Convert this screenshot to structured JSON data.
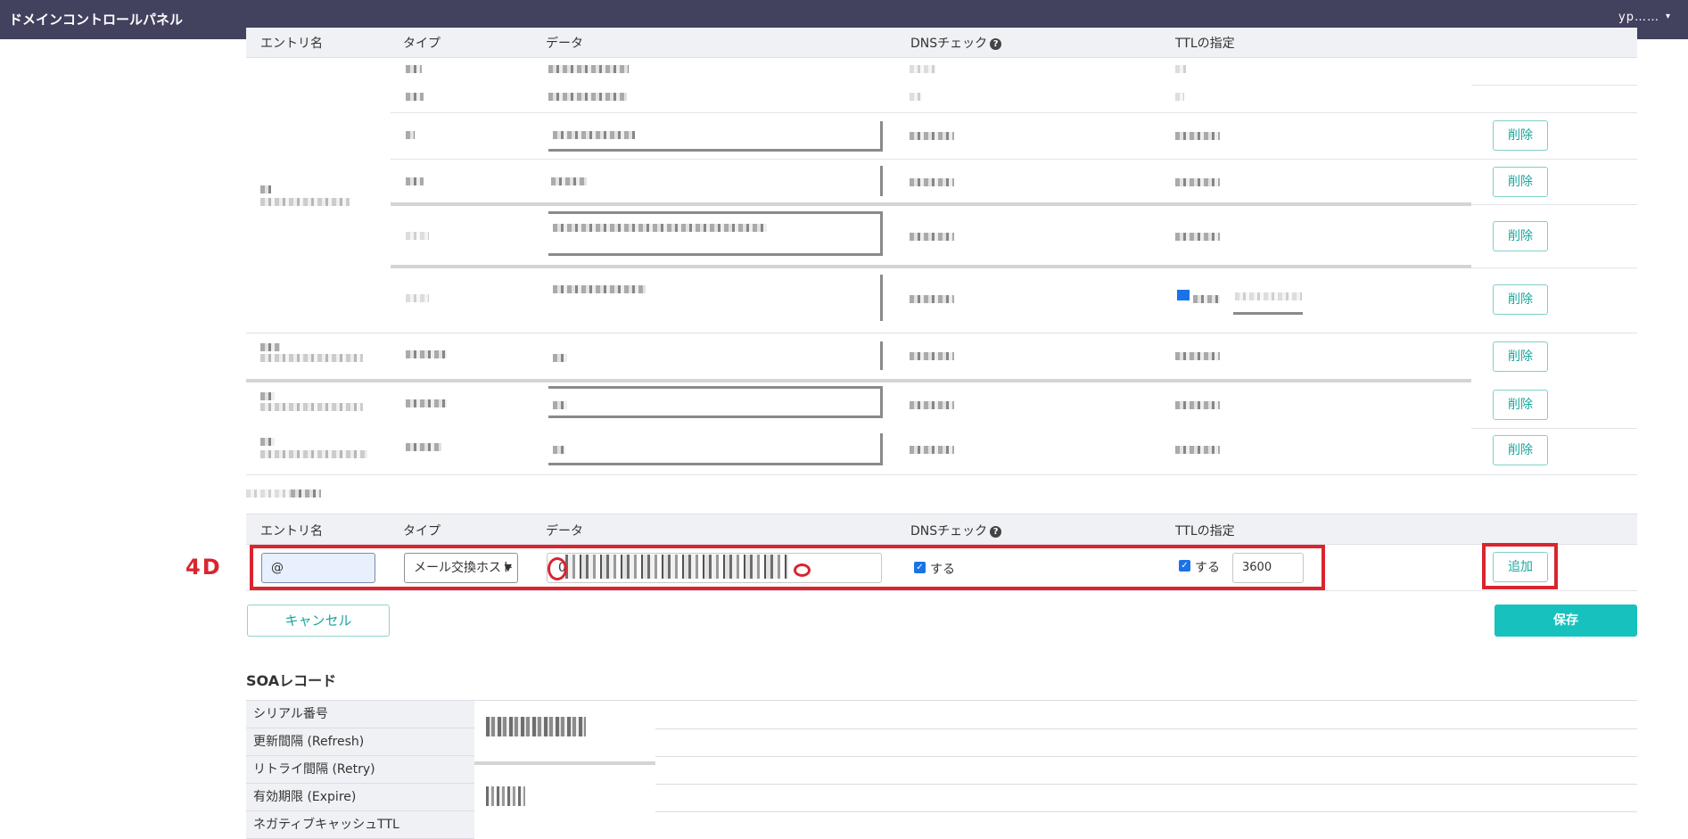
{
  "app": {
    "title": "ドメインコントロールパネル",
    "user": "yp……",
    "caret": "▾"
  },
  "records_table": {
    "headers": {
      "entry": "エントリ名",
      "type": "タイプ",
      "data": "データ",
      "dns": "DNSチェック",
      "ttl": "TTLの指定"
    },
    "help_glyph": "?",
    "delete_label": "削除"
  },
  "new_record": {
    "headers": {
      "entry": "エントリ名",
      "type": "タイプ",
      "data": "データ",
      "dns": "DNSチェック",
      "ttl": "TTLの指定"
    },
    "entry_value": "@",
    "type_value": "メール交換ホスト",
    "data_prefix": "0",
    "dns_check": {
      "checked": true,
      "label": "する"
    },
    "ttl_check": {
      "checked": true,
      "label": "する"
    },
    "ttl_value": "3600",
    "add_label": "追加",
    "annotation_tag": "4D",
    "annotation_color": "#d9252f"
  },
  "actions": {
    "cancel_label": "キャンセル",
    "save_label": "保存"
  },
  "soa": {
    "title": "SOAレコード",
    "rows": [
      {
        "label": "シリアル番号"
      },
      {
        "label": "更新間隔 (Refresh)"
      },
      {
        "label": "リトライ間隔 (Retry)"
      },
      {
        "label": "有効期限 (Expire)"
      },
      {
        "label": "ネガティブキャッシュTTL"
      }
    ]
  },
  "colors": {
    "topbar": "#42415e",
    "accent": "#17c2be",
    "accent_text": "#1aa79c",
    "annotation": "#d9252f"
  }
}
